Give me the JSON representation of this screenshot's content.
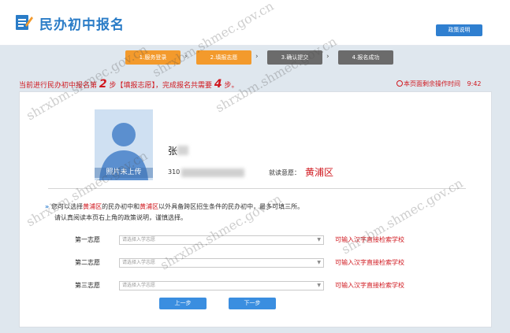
{
  "header": {
    "title": "民办初中报名",
    "policy_button": "政策说明"
  },
  "steps": [
    {
      "label": "1.服务登录",
      "state": "active"
    },
    {
      "label": "2.填报志愿",
      "state": "active"
    },
    {
      "label": "3.确认提交",
      "state": "inactive"
    },
    {
      "label": "4.报名成功",
      "state": "inactive"
    }
  ],
  "notice": {
    "prefix": "当前进行民办初中报名第",
    "step_no": "2",
    "middle": "步【填报志愿】，完成报名共需要",
    "total": "4",
    "suffix": "步。"
  },
  "timer": {
    "label": "本页面剩余操作时间",
    "value": "9:42"
  },
  "student": {
    "avatar_label": "照片未上传",
    "name": "张",
    "id_prefix": "310",
    "district_label": "就读意愿：",
    "district": "黄浦区"
  },
  "info": {
    "line1_a": "您可以选择",
    "line1_district1": "黄浦区",
    "line1_b": "的民办初中和",
    "line1_district2": "黄浦区",
    "line1_c": "以外具备跨区招生条件的民办初中，最多可填三所。",
    "line2": "请认真阅读本页右上角的政策说明，谨慎选择。"
  },
  "choices": [
    {
      "label": "第一志愿",
      "placeholder": "请选择入学志愿",
      "hint": "可输入汉字直接检索学校"
    },
    {
      "label": "第二志愿",
      "placeholder": "请选择入学志愿",
      "hint": "可输入汉字直接检索学校"
    },
    {
      "label": "第三志愿",
      "placeholder": "请选择入学志愿",
      "hint": "可输入汉字直接检索学校"
    }
  ],
  "buttons": {
    "prev": "上一步",
    "next": "下一步"
  },
  "watermark": "shrxbm.shmec.gov.cn",
  "colors": {
    "brand_blue": "#2a7cc7",
    "step_active": "#f39a2c",
    "step_inactive": "#6b6b6b",
    "alert_red": "#d0181f",
    "button_blue": "#3a8ee0"
  }
}
